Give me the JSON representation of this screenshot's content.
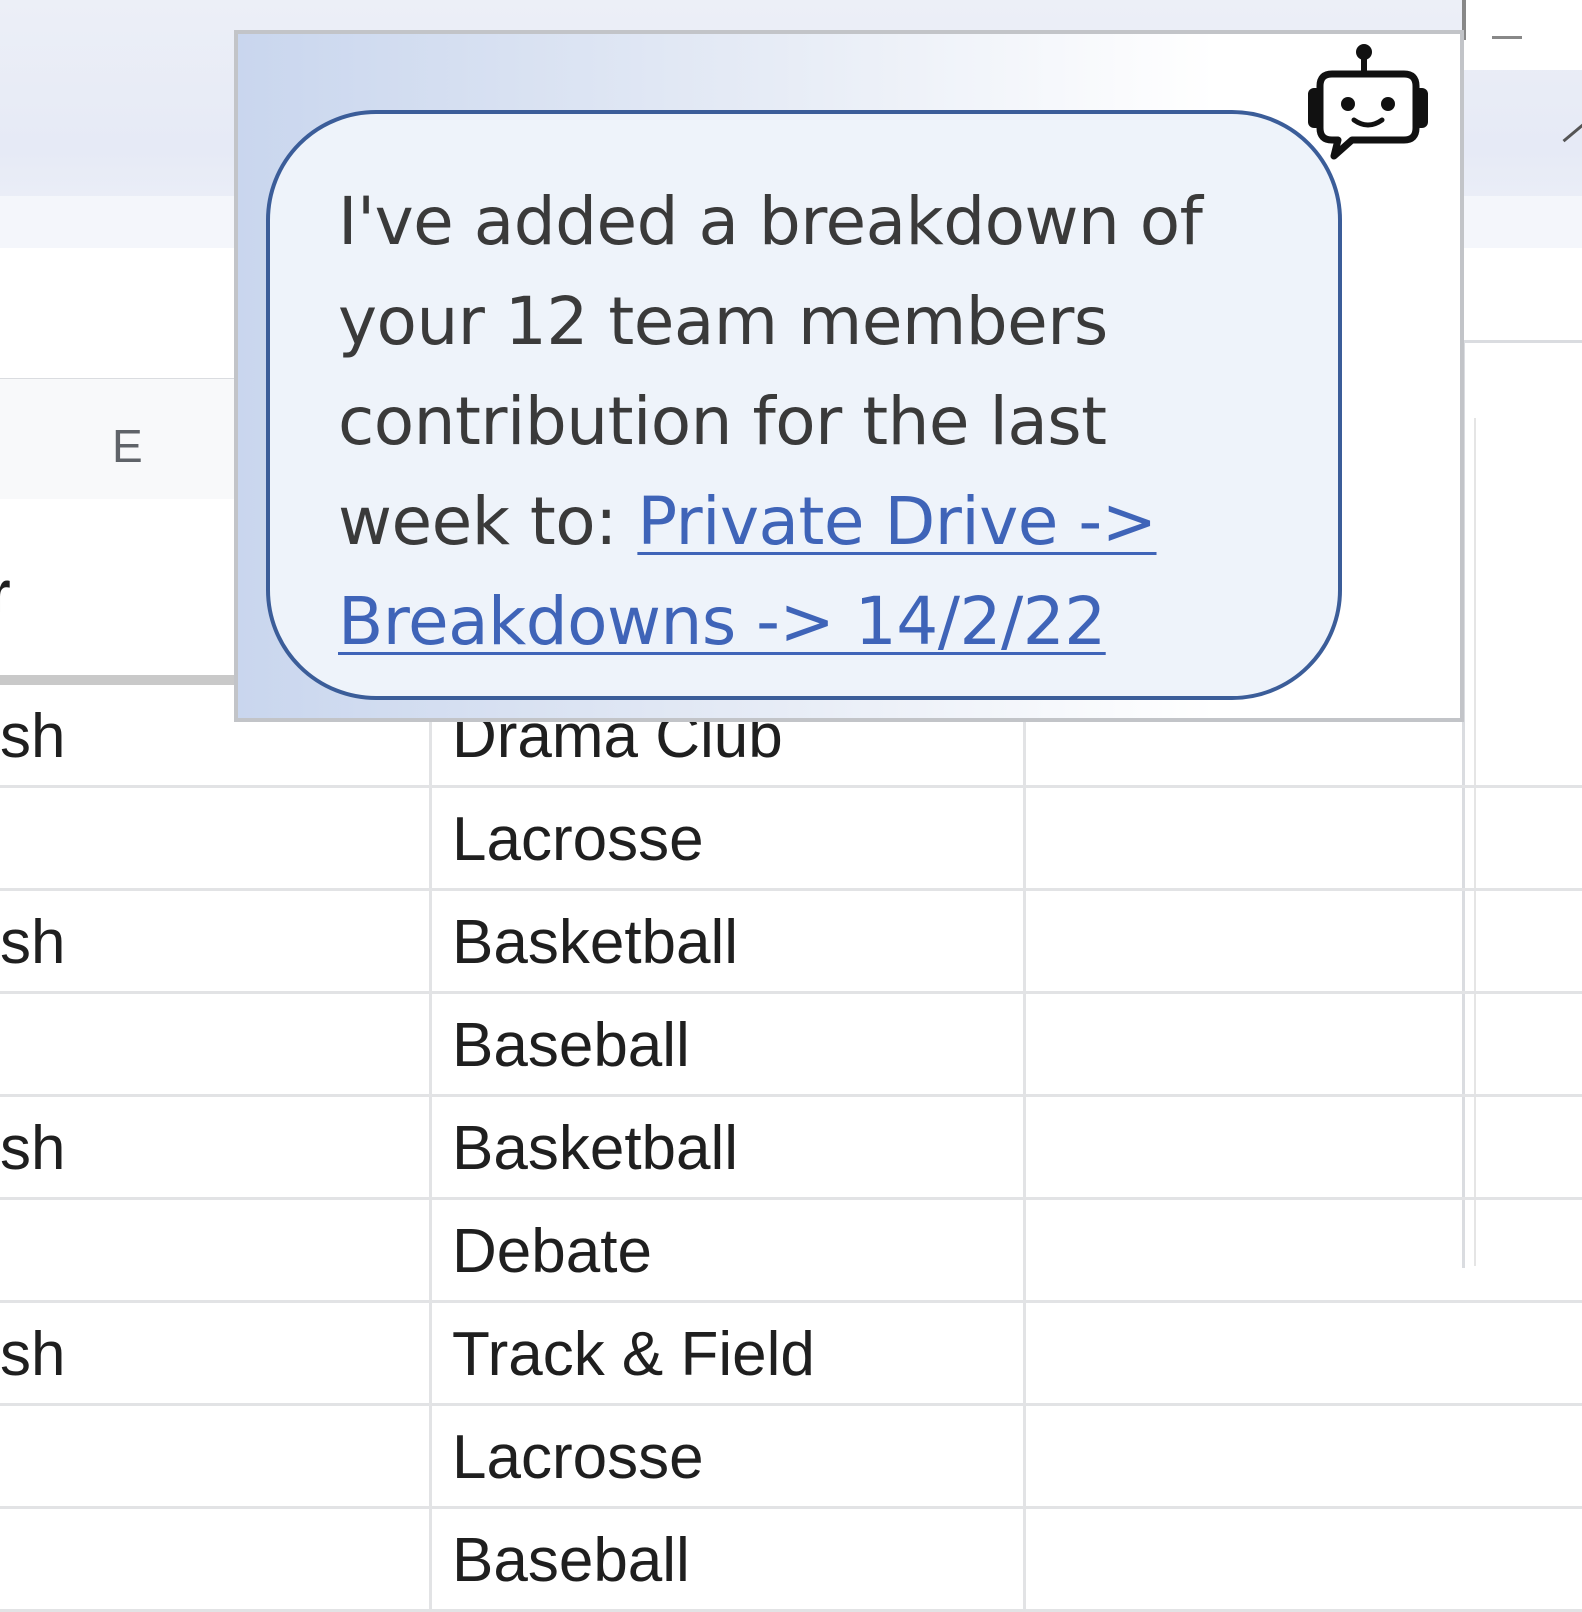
{
  "column_header": {
    "letter": "E"
  },
  "frozen_header": {
    "text": "r"
  },
  "rows": [
    {
      "d": "sh",
      "e": "Drama Club",
      "f": ""
    },
    {
      "d": "",
      "e": "Lacrosse",
      "f": ""
    },
    {
      "d": "sh",
      "e": "Basketball",
      "f": ""
    },
    {
      "d": "",
      "e": "Baseball",
      "f": ""
    },
    {
      "d": "sh",
      "e": "Basketball",
      "f": ""
    },
    {
      "d": "",
      "e": "Debate",
      "f": ""
    },
    {
      "d": "sh",
      "e": "Track & Field",
      "f": ""
    },
    {
      "d": "",
      "e": "Lacrosse",
      "f": ""
    },
    {
      "d": "",
      "e": "Baseball",
      "f": ""
    }
  ],
  "assistant": {
    "icon": "robot-chat-icon",
    "message_text": "I've added a breakdown of your 12 team members contribution for the last week to: ",
    "link_text": "Private Drive -> Breakdowns -> 14/2/22"
  },
  "colors": {
    "bubble_border": "#3b5d99",
    "link": "#3f64b8",
    "popup_gradient_start": "#c9d6ee"
  }
}
